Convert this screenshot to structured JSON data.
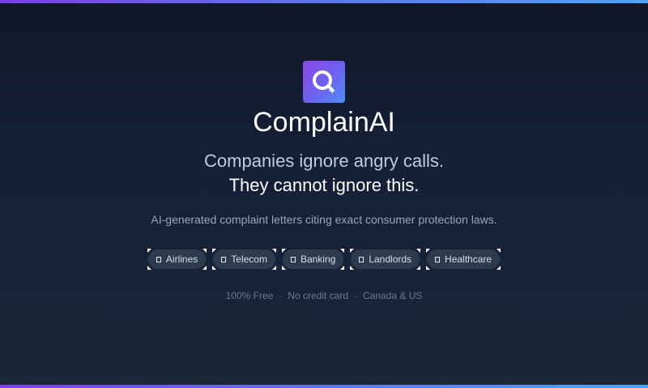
{
  "app": {
    "name": "ComplainAI",
    "logo_icon": "q-search-logo-icon"
  },
  "hero": {
    "headline_line1": "Companies ignore angry calls.",
    "headline_line2": "They cannot ignore this.",
    "subtitle": "AI-generated complaint letters citing exact consumer protection laws."
  },
  "categories": [
    {
      "label": "Airlines",
      "icon": "checkbox-icon"
    },
    {
      "label": "Telecom",
      "icon": "checkbox-icon"
    },
    {
      "label": "Banking",
      "icon": "checkbox-icon"
    },
    {
      "label": "Landlords",
      "icon": "checkbox-icon"
    },
    {
      "label": "Healthcare",
      "icon": "checkbox-icon"
    }
  ],
  "footer": {
    "items": [
      "100% Free",
      "No credit card",
      "Canada & US"
    ],
    "separator": "·"
  },
  "colors": {
    "accent_start": "#7b3fe4",
    "accent_end": "#4ea3f5",
    "background": "#131c30",
    "chip_bg": "#2e3a4d"
  }
}
